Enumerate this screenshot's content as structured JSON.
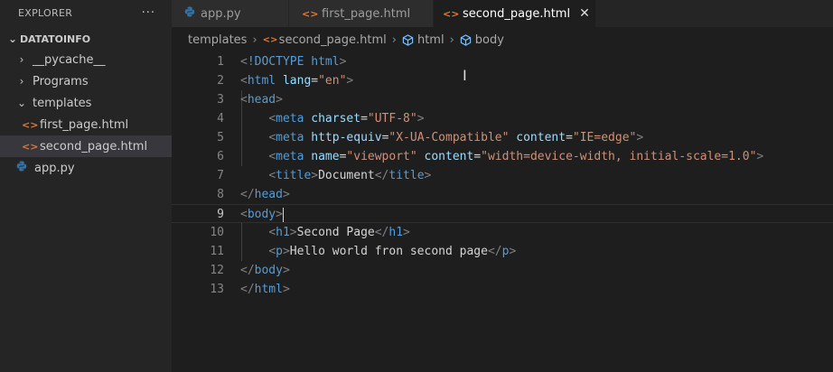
{
  "explorer": {
    "title": "EXPLORER",
    "more": "···",
    "root": "DATATOINFO",
    "items": [
      {
        "label": "__pycache__",
        "chevron": "›"
      },
      {
        "label": "Programs",
        "chevron": "›"
      },
      {
        "label": "templates",
        "chevron": "⌄"
      },
      {
        "label": "first_page.html",
        "icon": "<>"
      },
      {
        "label": "second_page.html",
        "icon": "<>"
      },
      {
        "label": "app.py"
      }
    ]
  },
  "tabs": [
    {
      "label": "app.py"
    },
    {
      "label": "first_page.html",
      "icon": "<>"
    },
    {
      "label": "second_page.html",
      "icon": "<>",
      "close": "✕"
    }
  ],
  "breadcrumb": [
    "templates",
    "second_page.html",
    "html",
    "body"
  ],
  "editor": {
    "line_numbers": [
      "1",
      "2",
      "3",
      "4",
      "5",
      "6",
      "7",
      "8",
      "9",
      "10",
      "11",
      "12",
      "13"
    ],
    "current_line": 9,
    "lines": [
      "<!DOCTYPE html>",
      "<html lang=\"en\">",
      "<head>",
      "    <meta charset=\"UTF-8\">",
      "    <meta http-equiv=\"X-UA-Compatible\" content=\"IE=edge\">",
      "    <meta name=\"viewport\" content=\"width=device-width, initial-scale=1.0\">",
      "    <title>Document</title>",
      "</head>",
      "<body>",
      "    <h1>Second Page</h1>",
      "    <p>Hello world fron second page</p>",
      "</body>",
      "</html>"
    ]
  },
  "colors": {
    "punct": "#808080",
    "tag": "#569cd6",
    "attr": "#9cdcfe",
    "string": "#ce9178",
    "text": "#d4d4d4",
    "html_icon": "#e37933",
    "python_icon": "#3572a5"
  }
}
